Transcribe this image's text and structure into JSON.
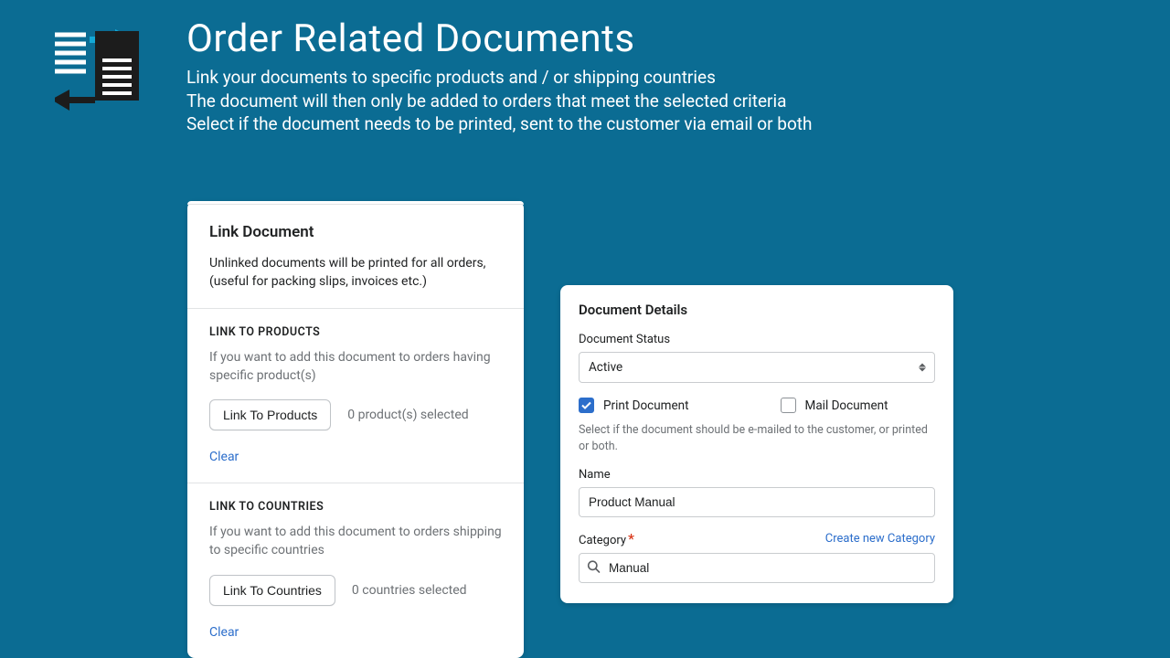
{
  "header": {
    "title": "Order Related Documents",
    "line1": "Link your documents to specific products and / or shipping countries",
    "line2": "The document will then only be added to orders that meet the selected criteria",
    "line3": "Select if the document needs to be printed, sent to the customer via email or both"
  },
  "link_card": {
    "title": "Link Document",
    "intro": "Unlinked documents will be printed for all orders, (useful for packing slips, invoices etc.)",
    "products": {
      "title": "LINK TO PRODUCTS",
      "desc": "If you want to add this document to orders having specific product(s)",
      "button": "Link To Products",
      "count_text": "0 product(s) selected",
      "clear": "Clear"
    },
    "countries": {
      "title": "LINK TO COUNTRIES",
      "desc": "If you want to add this document to orders shipping to specific countries",
      "button": "Link To Countries",
      "count_text": "0 countries selected",
      "clear": "Clear"
    }
  },
  "details": {
    "title": "Document Details",
    "status_label": "Document Status",
    "status_value": "Active",
    "print_label": "Print Document",
    "mail_label": "Mail Document",
    "hint": "Select if the document should be e-mailed to the customer, or printed or both.",
    "name_label": "Name",
    "name_value": "Product Manual",
    "category_label": "Category",
    "create_category": "Create new Category",
    "category_value": "Manual"
  }
}
